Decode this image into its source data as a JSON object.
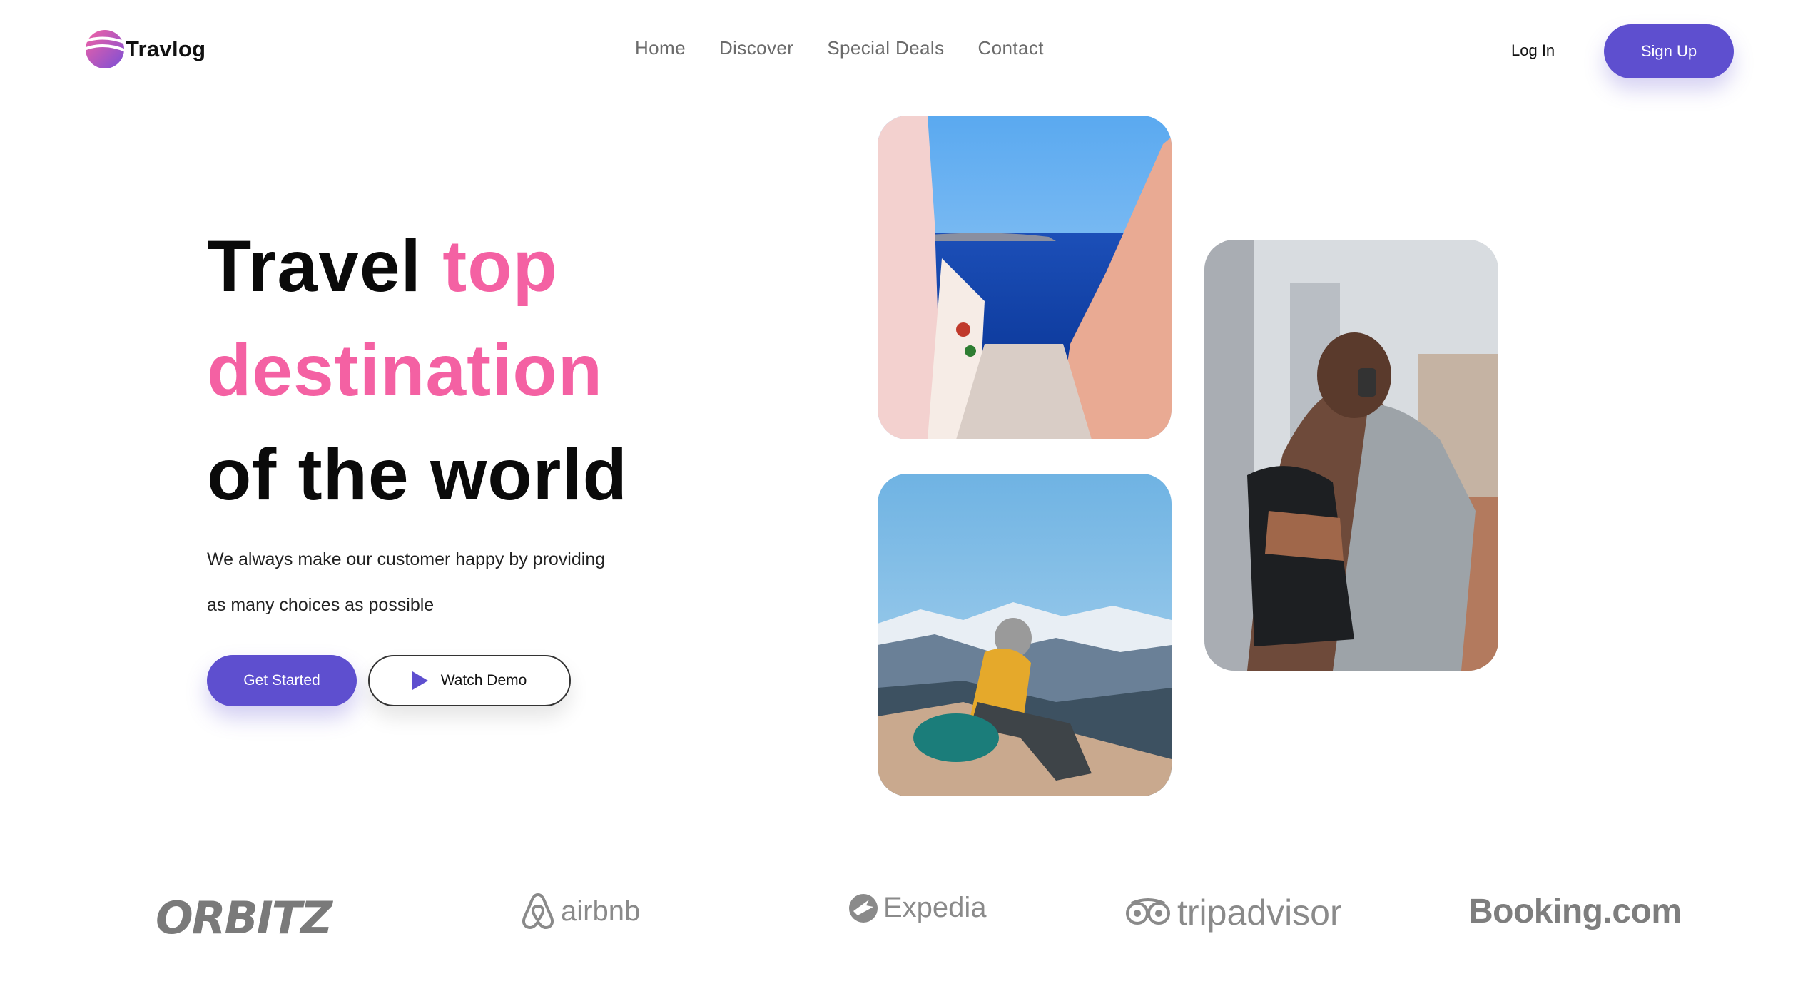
{
  "header": {
    "brand": "Travlog",
    "nav": [
      "Home",
      "Discover",
      "Special Deals",
      "Contact"
    ],
    "login_label": "Log In",
    "signup_label": "Sign Up"
  },
  "hero": {
    "title_word1": "Travel",
    "title_word2": "top",
    "title_line2": "destination",
    "title_line3": "of the world",
    "subtitle_line1": "We always make our customer happy by providing",
    "subtitle_line2": "as many choices as possible",
    "cta_primary": "Get Started",
    "cta_secondary": "Watch Demo"
  },
  "partners": [
    "ORBITZ",
    "airbnb",
    "Expedia",
    "tripadvisor",
    "Booking.com"
  ],
  "colors": {
    "accent": "#5e4fcf",
    "pink": "#f461a3",
    "text": "#0a0a0a"
  },
  "icons": [
    "travlog-logo-icon",
    "play-icon",
    "airbnb-icon",
    "expedia-icon",
    "tripadvisor-icon"
  ]
}
